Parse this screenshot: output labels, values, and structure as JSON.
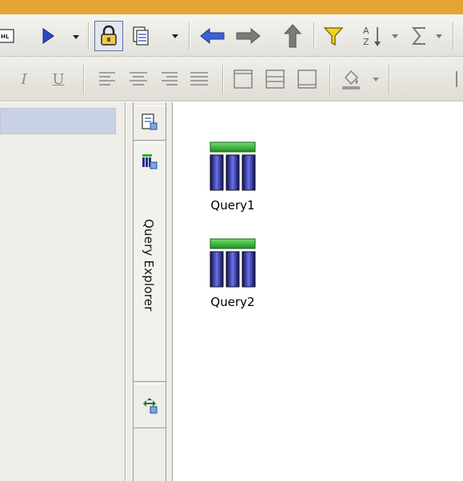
{
  "toolbar1": {
    "buttons": [
      {
        "icon": "html-icon"
      },
      {
        "icon": "run-icon"
      },
      {
        "icon": "run-dropdown-icon"
      },
      {
        "icon": "lock-icon",
        "pressed": true
      },
      {
        "icon": "copy-page-icon"
      },
      {
        "icon": "back-arrow-icon"
      },
      {
        "icon": "forward-arrow-icon"
      },
      {
        "icon": "up-arrow-icon"
      },
      {
        "icon": "filter-icon"
      },
      {
        "icon": "sort-icon"
      },
      {
        "icon": "sum-icon"
      }
    ]
  },
  "toolbar2": {
    "buttons": [
      {
        "icon": "italic-icon",
        "label": "I"
      },
      {
        "icon": "underline-icon",
        "label": "U"
      },
      {
        "icon": "align-left-icon"
      },
      {
        "icon": "align-center-icon"
      },
      {
        "icon": "align-right-icon"
      },
      {
        "icon": "justify-icon"
      },
      {
        "icon": "border-top-icon"
      },
      {
        "icon": "border-middle-icon"
      },
      {
        "icon": "border-bottom-icon"
      },
      {
        "icon": "fill-color-icon"
      }
    ]
  },
  "side_tabs": {
    "query_explorer_label": "Query Explorer"
  },
  "canvas": {
    "queries": [
      {
        "label": "Query1"
      },
      {
        "label": "Query2"
      }
    ]
  },
  "colors": {
    "accent_strip": "#e6a435",
    "toolbar_bg": "#ecebe5",
    "left_header": "#c9d1e4",
    "query_green": "#2fae2f",
    "query_blue": "#2a2a8a"
  }
}
